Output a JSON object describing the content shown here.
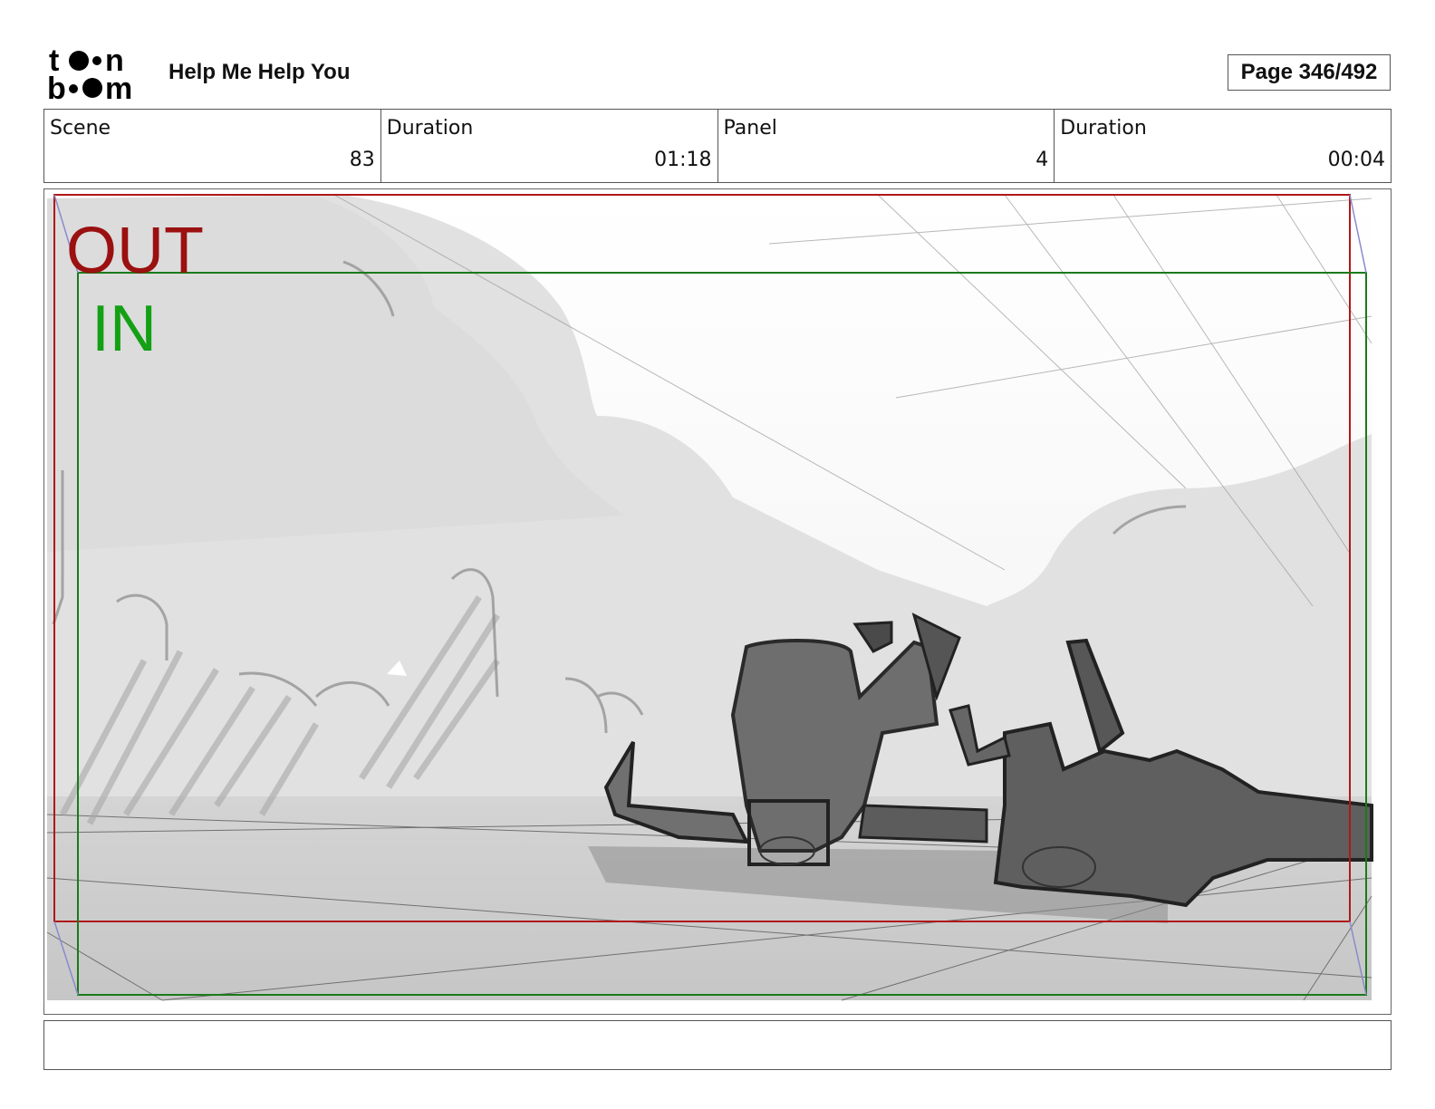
{
  "header": {
    "logo_text": "toon boom",
    "project_title": "Help Me Help You",
    "page_label": "Page 346/492"
  },
  "info": {
    "scene_label": "Scene",
    "scene_value": "83",
    "scene_duration_label": "Duration",
    "scene_duration_value": "01:18",
    "panel_label": "Panel",
    "panel_value": "4",
    "panel_duration_label": "Duration",
    "panel_duration_value": "00:04"
  },
  "camera": {
    "out_label": "OUT",
    "in_label": "IN",
    "out_color": "#9b1010",
    "in_color": "#14a014"
  },
  "notes": {
    "text": ""
  }
}
